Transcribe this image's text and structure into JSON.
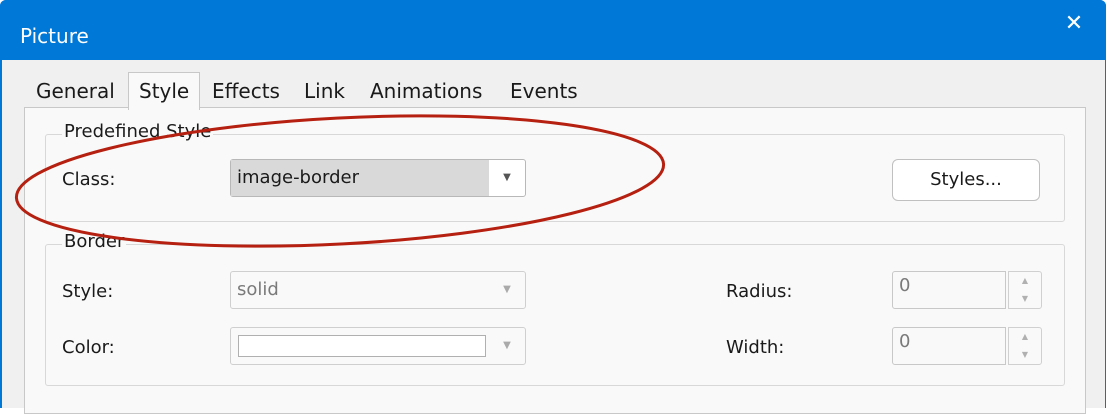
{
  "window": {
    "title": "Picture",
    "close_glyph": "✕"
  },
  "tabs": [
    {
      "label": "General"
    },
    {
      "label": "Style",
      "active": true
    },
    {
      "label": "Effects"
    },
    {
      "label": "Link"
    },
    {
      "label": "Animations"
    },
    {
      "label": "Events"
    }
  ],
  "predefined_style": {
    "group_label": "Predefined Style",
    "class_label": "Class:",
    "class_value": "image-border",
    "styles_button": "Styles..."
  },
  "border": {
    "group_label": "Border",
    "style_label": "Style:",
    "style_value": "solid",
    "color_label": "Color:",
    "radius_label": "Radius:",
    "radius_value": "0",
    "width_label": "Width:",
    "width_value": "0"
  },
  "icons": {
    "dropdown": "▼",
    "spin_up": "▲",
    "spin_down": "▼"
  },
  "colors": {
    "title_bar": "#0078d7",
    "highlight_ellipse": "#b52010"
  }
}
